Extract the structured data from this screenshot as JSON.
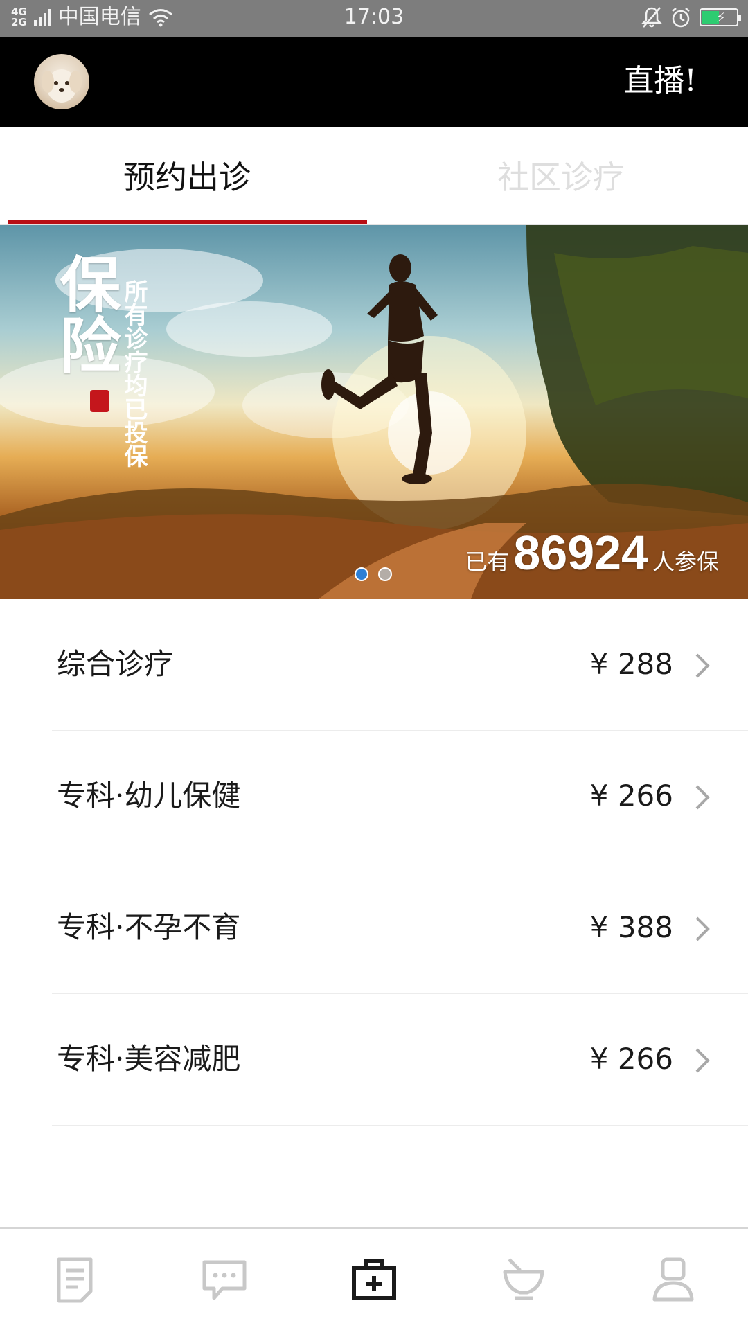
{
  "status_bar": {
    "network": "4G",
    "network_alt": "2G",
    "carrier": "中国电信",
    "time": "17:03",
    "icons": [
      "signal-icon",
      "wifi-icon",
      "mute-icon",
      "alarm-icon",
      "battery-icon"
    ]
  },
  "header": {
    "avatar_icon": "avatar",
    "live_label": "直播!"
  },
  "tabs": [
    {
      "label": "预约出诊",
      "active": true
    },
    {
      "label": "社区诊疗",
      "active": false
    }
  ],
  "banner": {
    "title": "保险",
    "subtitle": "所有诊疗均已投保",
    "count_prefix": "已有",
    "count_value": "86924",
    "count_suffix": "人参保",
    "slide_count": 2,
    "active_slide": 1
  },
  "services": [
    {
      "name": "综合诊疗",
      "price": "¥ 288"
    },
    {
      "name": "专科·幼儿保健",
      "price": "¥ 266"
    },
    {
      "name": "专科·不孕不育",
      "price": "¥ 388"
    },
    {
      "name": "专科·美容减肥",
      "price": "¥ 266"
    }
  ],
  "bottom_nav": [
    {
      "icon": "document-icon",
      "active": false
    },
    {
      "icon": "chat-icon",
      "active": false
    },
    {
      "icon": "medical-kit-icon",
      "active": true
    },
    {
      "icon": "mortar-icon",
      "active": false
    },
    {
      "icon": "profile-icon",
      "active": false
    }
  ],
  "colors": {
    "accent": "#b80f15",
    "header_bg": "#000000",
    "status_bar_bg": "#7d7d7d",
    "inactive_icon": "#c8c8c8",
    "active_icon": "#1a1a1a",
    "active_dot": "#2c7fd6"
  }
}
